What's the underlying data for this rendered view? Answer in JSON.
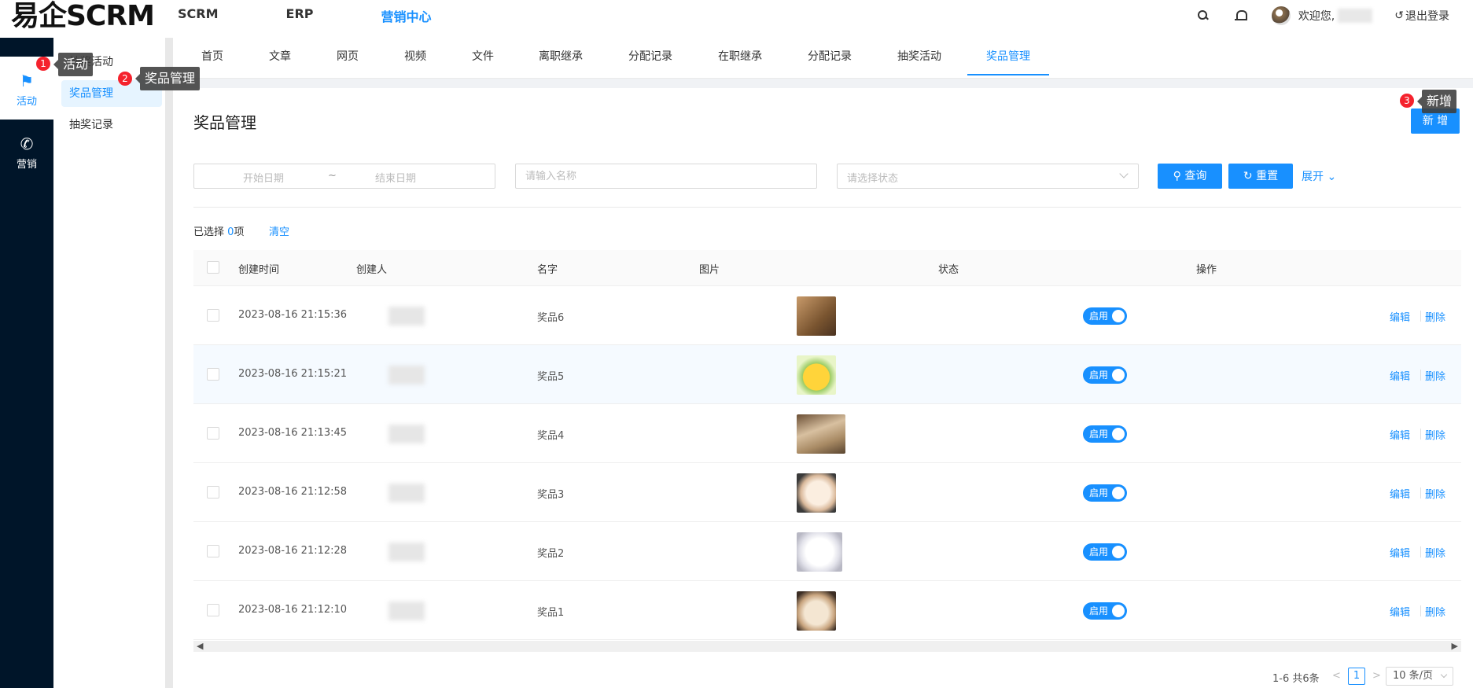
{
  "app": {
    "logo": "易企SCRM",
    "top_nav": [
      {
        "label": "SCRM"
      },
      {
        "label": "ERP"
      },
      {
        "label": "营销中心",
        "active": true
      }
    ],
    "user": {
      "welcome": "欢迎您,",
      "logout": "退出登录"
    }
  },
  "rail": [
    {
      "label": "活动",
      "icon": "flag-icon",
      "active": true
    },
    {
      "label": "营销",
      "icon": "phone-icon"
    }
  ],
  "submenu": [
    {
      "label": "抽奖活动"
    },
    {
      "label": "奖品管理",
      "active": true
    },
    {
      "label": "抽奖记录"
    }
  ],
  "tabs": [
    {
      "label": "首页"
    },
    {
      "label": "文章"
    },
    {
      "label": "网页"
    },
    {
      "label": "视频"
    },
    {
      "label": "文件"
    },
    {
      "label": "离职继承"
    },
    {
      "label": "分配记录"
    },
    {
      "label": "在职继承"
    },
    {
      "label": "分配记录"
    },
    {
      "label": "抽奖活动"
    },
    {
      "label": "奖品管理",
      "active": true
    }
  ],
  "page": {
    "title": "奖品管理",
    "new_button": "新 增"
  },
  "filters": {
    "start_date_placeholder": "开始日期",
    "date_separator": "~",
    "end_date_placeholder": "结束日期",
    "name_placeholder": "请输入名称",
    "status_placeholder": "请选择状态",
    "query_button": "查询",
    "reset_button": "重置",
    "expand_link": "展开"
  },
  "selection": {
    "prefix": "已选择 ",
    "count": "0",
    "suffix": "项",
    "clear": "清空"
  },
  "table": {
    "columns": [
      "创建时间",
      "创建人",
      "名字",
      "图片",
      "状态",
      "操作"
    ],
    "rows": [
      {
        "created_at": "2023-08-16 21:15:36",
        "name": "奖品6",
        "status": "启用",
        "edit": "编辑",
        "delete": "删除",
        "image": "cat-photo"
      },
      {
        "created_at": "2023-08-16 21:15:21",
        "name": "奖品5",
        "status": "启用",
        "edit": "编辑",
        "delete": "删除",
        "image": "psyduck-sticker"
      },
      {
        "created_at": "2023-08-16 21:13:45",
        "name": "奖品4",
        "status": "启用",
        "edit": "编辑",
        "delete": "删除",
        "image": "stool-photo"
      },
      {
        "created_at": "2023-08-16 21:12:58",
        "name": "奖品3",
        "status": "启用",
        "edit": "编辑",
        "delete": "删除",
        "image": "kitten-photo"
      },
      {
        "created_at": "2023-08-16 21:12:28",
        "name": "奖品2",
        "status": "启用",
        "edit": "编辑",
        "delete": "删除",
        "image": "white-cat-photo"
      },
      {
        "created_at": "2023-08-16 21:12:10",
        "name": "奖品1",
        "status": "启用",
        "edit": "编辑",
        "delete": "删除",
        "image": "puppy-photo"
      }
    ]
  },
  "pagination": {
    "total": "1-6 共6条",
    "current": "1",
    "page_size": "10 条/页"
  },
  "annotations": [
    {
      "number": "1",
      "label": "活动"
    },
    {
      "number": "2",
      "label": "奖品管理"
    },
    {
      "number": "3",
      "label": "新增"
    }
  ],
  "colors": {
    "primary": "#1890ff",
    "rail_bg": "#001529",
    "badge": "#f5222d"
  }
}
